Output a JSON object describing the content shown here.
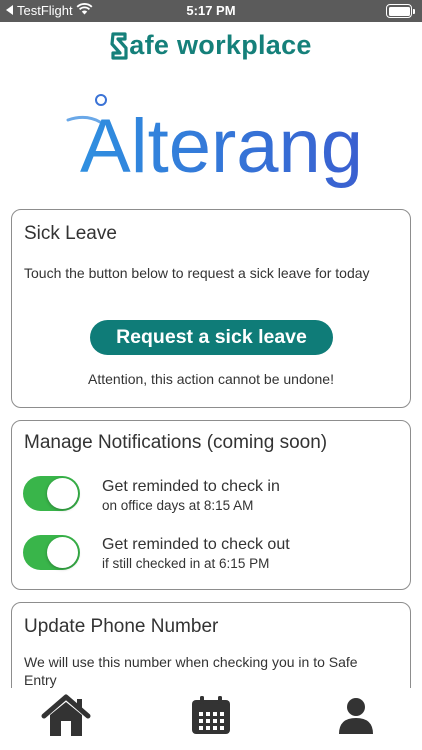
{
  "status_bar": {
    "back_label": "TestFlight",
    "time": "5:17 PM"
  },
  "brand": {
    "app_name": "afe workplace",
    "logo_text": "Alterang",
    "colors": {
      "brand_teal": "#15807a",
      "logo_blue": "#3b73d6",
      "toggle_green": "#39b54a"
    }
  },
  "sick_leave": {
    "title": "Sick Leave",
    "description": "Touch the button below to request a sick leave for today",
    "button_label": "Request a sick leave",
    "warning": "Attention, this action cannot be undone!"
  },
  "notifications": {
    "title": "Manage Notifications (coming soon)",
    "items": [
      {
        "label": "Get reminded to check in",
        "sublabel": "on office days at 8:15 AM",
        "enabled": true
      },
      {
        "label": "Get reminded to check out",
        "sublabel": "if still checked in at 6:15 PM",
        "enabled": true
      }
    ]
  },
  "phone": {
    "title": "Update Phone Number",
    "description": "We will use this number when checking you in to Safe Entry"
  },
  "tab_bar": {
    "items": [
      {
        "icon": "home-icon"
      },
      {
        "icon": "calendar-icon"
      },
      {
        "icon": "profile-icon"
      }
    ]
  }
}
